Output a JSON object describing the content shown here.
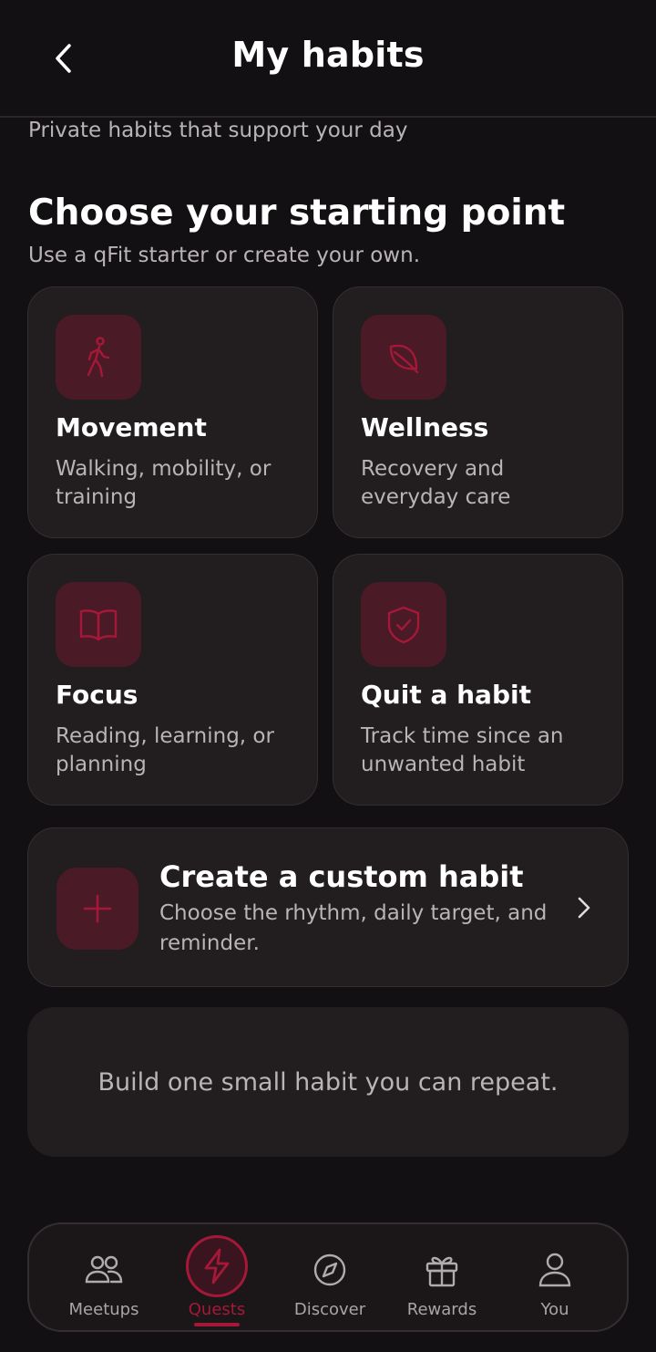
{
  "header": {
    "title": "My habits"
  },
  "subtitle": "Private habits that support your day",
  "section": {
    "title": "Choose your starting point",
    "subtitle": "Use a qFit starter or create your own."
  },
  "cards": [
    {
      "title": "Movement",
      "desc": "Walking, mobility, or training",
      "icon": "walking-icon"
    },
    {
      "title": "Wellness",
      "desc": "Recovery and everyday care",
      "icon": "leaf-icon"
    },
    {
      "title": "Focus",
      "desc": "Reading, learning, or planning",
      "icon": "book-icon"
    },
    {
      "title": "Quit a habit",
      "desc": "Track time since an unwanted habit",
      "icon": "shield-check-icon"
    }
  ],
  "custom": {
    "title": "Create a custom habit",
    "desc": "Choose the rhythm, daily target, and reminder."
  },
  "tip": "Build one small habit you can repeat.",
  "nav": [
    {
      "label": "Meetups",
      "icon": "people-icon"
    },
    {
      "label": "Quests",
      "icon": "lightning-icon",
      "active": true
    },
    {
      "label": "Discover",
      "icon": "compass-icon"
    },
    {
      "label": "Rewards",
      "icon": "gift-icon"
    },
    {
      "label": "You",
      "icon": "person-icon"
    }
  ],
  "colors": {
    "accent": "#a51838",
    "icon_tile": "#4a1a26",
    "card_bg": "#221d1f",
    "background": "#121012"
  }
}
